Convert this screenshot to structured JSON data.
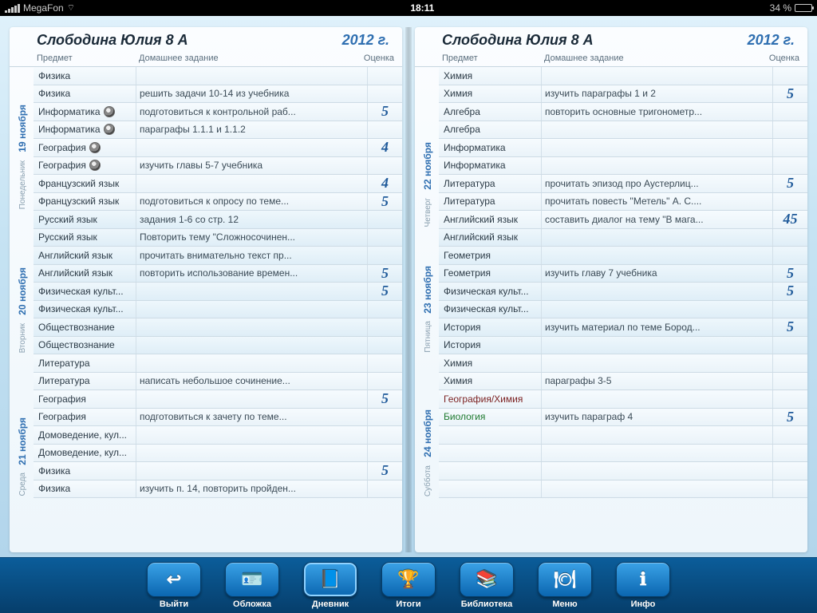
{
  "status": {
    "carrier": "MegaFon",
    "time": "18:11",
    "battery": "34 %"
  },
  "header": {
    "student": "Слободина Юлия 8 А",
    "year": "2012 г.",
    "col_subject": "Предмет",
    "col_homework": "Домашнее задание",
    "col_grade": "Оценка"
  },
  "left_days": [
    {
      "date": "19 ноября",
      "weekday": "Понедельник",
      "rows": [
        {
          "subject": "Физика",
          "hw": "",
          "grade": ""
        },
        {
          "subject": "Физика",
          "hw": "решить задачи 10-14 из учебника",
          "grade": ""
        },
        {
          "subject": "Информатика",
          "cam": true,
          "hw": "подготовиться к контрольной раб...",
          "grade": "5"
        },
        {
          "subject": "Информатика",
          "cam": true,
          "hw": "параграфы 1.1.1 и 1.1.2",
          "grade": ""
        },
        {
          "subject": "География",
          "cam": true,
          "hw": "",
          "grade": "4"
        },
        {
          "subject": "География",
          "cam": true,
          "hw": "изучить главы 5-7 учебника",
          "grade": ""
        },
        {
          "subject": "Французский язык",
          "hw": "",
          "grade": "4"
        },
        {
          "subject": "Французский язык",
          "hw": "подготовиться к опросу по теме...",
          "grade": "5"
        }
      ]
    },
    {
      "date": "20 ноября",
      "weekday": "Вторник",
      "rows": [
        {
          "subject": "Русский язык",
          "hw": "задания 1-6 со стр. 12",
          "grade": ""
        },
        {
          "subject": "Русский язык",
          "hw": "Повторить тему \"Сложносочинен...",
          "grade": ""
        },
        {
          "subject": "Английский язык",
          "hw": "прочитать внимательно текст пр...",
          "grade": ""
        },
        {
          "subject": "Английский язык",
          "hw": "повторить использование времен...",
          "grade": "5"
        },
        {
          "subject": "Физическая культ...",
          "hw": "",
          "grade": "5"
        },
        {
          "subject": "Физическая культ...",
          "hw": "",
          "grade": ""
        },
        {
          "subject": "Обществознание",
          "hw": "",
          "grade": ""
        },
        {
          "subject": "Обществознание",
          "hw": "",
          "grade": ""
        }
      ]
    },
    {
      "date": "21 ноября",
      "weekday": "Среда",
      "rows": [
        {
          "subject": "Литература",
          "hw": "",
          "grade": ""
        },
        {
          "subject": "Литература",
          "hw": "написать небольшое сочинение...",
          "grade": ""
        },
        {
          "subject": "География",
          "hw": "",
          "grade": "5"
        },
        {
          "subject": "География",
          "hw": "подготовиться к зачету по теме...",
          "grade": ""
        },
        {
          "subject": "Домоведение, кул...",
          "hw": "",
          "grade": ""
        },
        {
          "subject": "Домоведение, кул...",
          "hw": "",
          "grade": ""
        },
        {
          "subject": "Физика",
          "hw": "",
          "grade": "5"
        },
        {
          "subject": "Физика",
          "hw": "изучить п. 14, повторить пройден...",
          "grade": ""
        }
      ]
    }
  ],
  "right_days": [
    {
      "date": "22 ноября",
      "weekday": "Четверг",
      "rows": [
        {
          "subject": "Химия",
          "hw": "",
          "grade": ""
        },
        {
          "subject": "Химия",
          "hw": "изучить параграфы 1 и 2",
          "grade": "5"
        },
        {
          "subject": "Алгебра",
          "hw": "повторить основные тригонометр...",
          "grade": ""
        },
        {
          "subject": "Алгебра",
          "hw": "",
          "grade": ""
        },
        {
          "subject": "Информатика",
          "hw": "",
          "grade": ""
        },
        {
          "subject": "Информатика",
          "hw": "",
          "grade": ""
        },
        {
          "subject": "Литература",
          "hw": "прочитать эпизод про Аустерлиц...",
          "grade": "5"
        },
        {
          "subject": "Литература",
          "hw": "прочитать повесть \"Метель\" А. С....",
          "grade": ""
        },
        {
          "subject": "Английский язык",
          "hw": "составить диалог на тему \"В мага...",
          "grade": "45"
        }
      ]
    },
    {
      "date": "23 ноября",
      "weekday": "Пятница",
      "rows": [
        {
          "subject": "Английский язык",
          "hw": "",
          "grade": ""
        },
        {
          "subject": "Геометрия",
          "hw": "",
          "grade": ""
        },
        {
          "subject": "Геометрия",
          "hw": "изучить главу 7 учебника",
          "grade": "5"
        },
        {
          "subject": "Физическая культ...",
          "hw": "",
          "grade": "5"
        },
        {
          "subject": "Физическая культ...",
          "hw": "",
          "grade": ""
        },
        {
          "subject": "История",
          "hw": "изучить материал по теме Бород...",
          "grade": "5"
        },
        {
          "subject": "История",
          "hw": "",
          "grade": ""
        }
      ]
    },
    {
      "date": "24 ноября",
      "weekday": "Суббота",
      "rows": [
        {
          "subject": "Химия",
          "hw": "",
          "grade": ""
        },
        {
          "subject": "Химия",
          "hw": "параграфы 3-5",
          "grade": ""
        },
        {
          "subject": "География/Химия",
          "color": "red",
          "hw": "",
          "grade": ""
        },
        {
          "subject": "Биология",
          "color": "green",
          "hw": "изучить параграф 4",
          "grade": "5"
        },
        {
          "subject": "",
          "hw": "",
          "grade": ""
        },
        {
          "subject": "",
          "hw": "",
          "grade": ""
        },
        {
          "subject": "",
          "hw": "",
          "grade": ""
        },
        {
          "subject": "",
          "hw": "",
          "grade": ""
        }
      ]
    }
  ],
  "toolbar": [
    {
      "id": "exit",
      "label": "Выйти",
      "glyph": "↩"
    },
    {
      "id": "cover",
      "label": "Обложка",
      "glyph": "🪪"
    },
    {
      "id": "diary",
      "label": "Дневник",
      "glyph": "📘",
      "active": true
    },
    {
      "id": "results",
      "label": "Итоги",
      "glyph": "🏆"
    },
    {
      "id": "library",
      "label": "Библиотека",
      "glyph": "📚"
    },
    {
      "id": "menu",
      "label": "Меню",
      "glyph": "🍽"
    },
    {
      "id": "info",
      "label": "Инфо",
      "glyph": "ℹ"
    }
  ]
}
